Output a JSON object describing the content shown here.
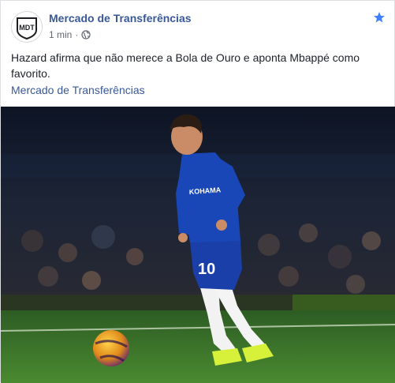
{
  "post": {
    "page_name": "Mercado de Transferências",
    "timestamp": "1 min",
    "separator": "·",
    "avatar_text": "MDT",
    "text": "Hazard afirma que não merece a Bola de Ouro e aponta Mbappé como favorito.",
    "link_label": "Mercado de Transferências",
    "shirt_number": "10",
    "sponsor": "YOKOHAMA"
  },
  "icons": {
    "visibility": "globe-icon",
    "favorite": "star-icon"
  },
  "colors": {
    "link": "#385898",
    "meta": "#616770",
    "star": "#4080ff",
    "kit": "#1a3fa8",
    "pitch": "#3f7a2a"
  }
}
